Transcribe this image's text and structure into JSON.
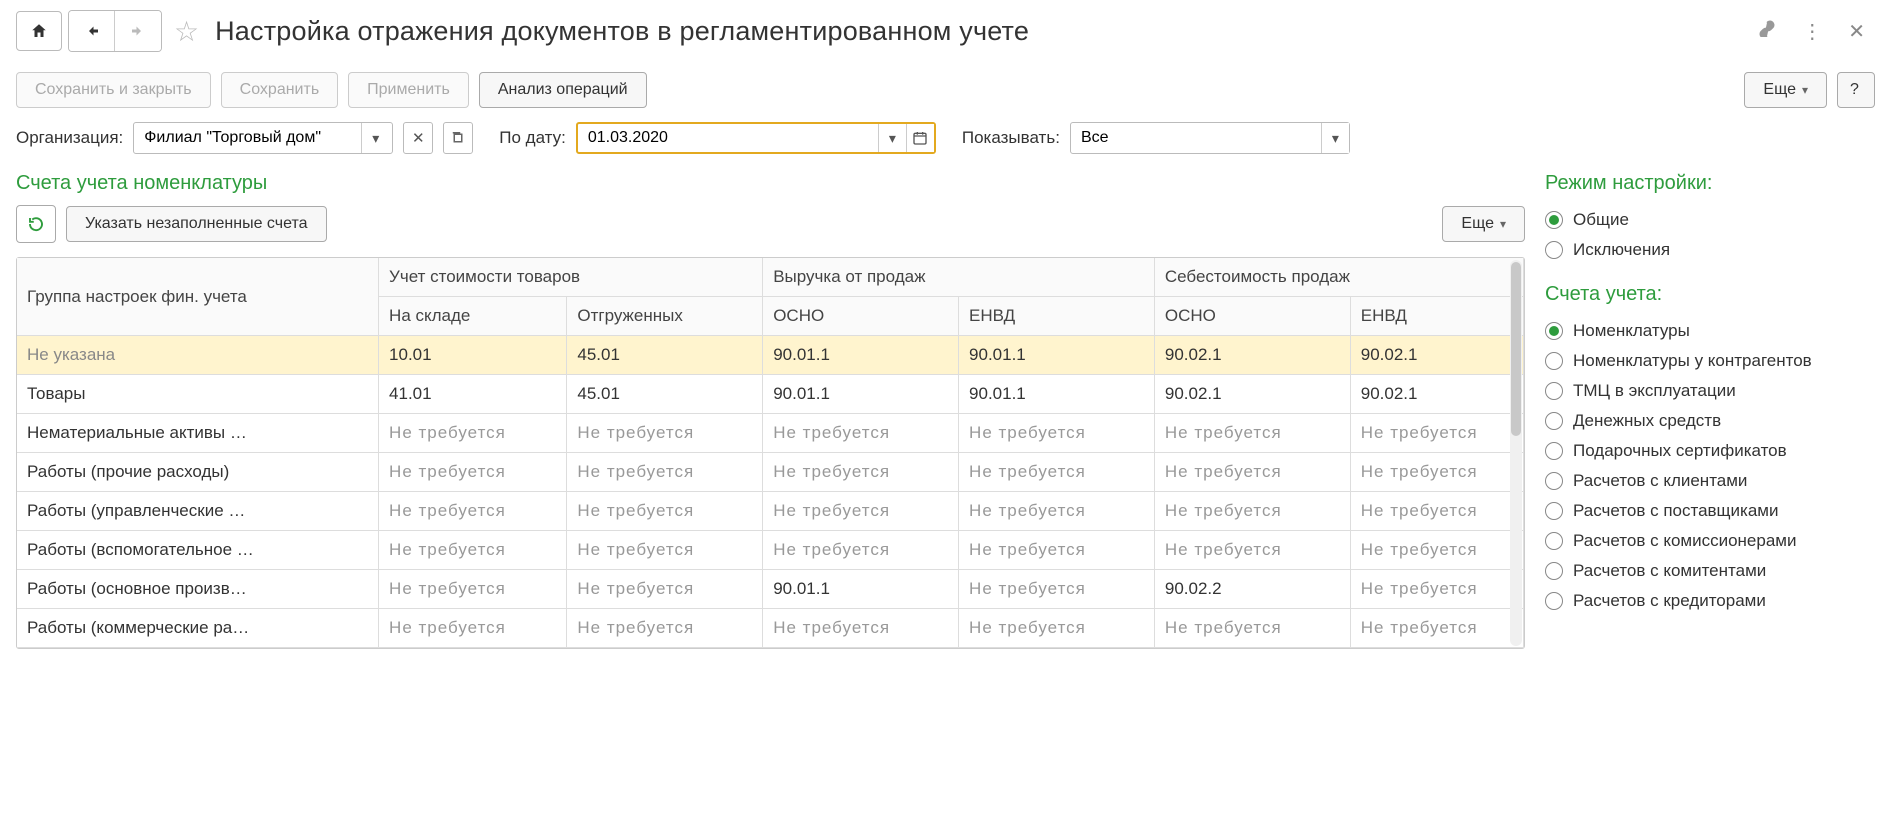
{
  "header": {
    "title": "Настройка отражения документов в регламентированном учете"
  },
  "toolbar": {
    "save_close": "Сохранить и закрыть",
    "save": "Сохранить",
    "apply": "Применить",
    "analyze": "Анализ операций",
    "more": "Еще",
    "help": "?"
  },
  "filters": {
    "org_label": "Организация:",
    "org_value": "Филиал \"Торговый дом\"",
    "date_label": "По дату:",
    "date_value": "01.03.2020",
    "show_label": "Показывать:",
    "show_value": "Все"
  },
  "section": {
    "title": "Счета учета номенклатуры",
    "fill_empty": "Указать незаполненные счета",
    "more": "Еще"
  },
  "table": {
    "columns": {
      "group": "Группа настроек фин. учета",
      "cost_group": "Учет стоимости товаров",
      "cost_stock": "На складе",
      "cost_shipped": "Отгруженных",
      "revenue_group": "Выручка от продаж",
      "rev_osno": "ОСНО",
      "rev_envd": "ЕНВД",
      "prime_group": "Себестоимость продаж",
      "prime_osno": "ОСНО",
      "prime_envd": "ЕНВД"
    },
    "na": "Не требуется",
    "rows": [
      {
        "name": "Не указана",
        "sel": true,
        "stock": "10.01",
        "shipped": "45.01",
        "rev_osno": "90.01.1",
        "rev_envd": "90.01.1",
        "prime_osno": "90.02.1",
        "prime_envd": "90.02.1"
      },
      {
        "name": "Товары",
        "sel": false,
        "stock": "41.01",
        "shipped": "45.01",
        "rev_osno": "90.01.1",
        "rev_envd": "90.01.1",
        "prime_osno": "90.02.1",
        "prime_envd": "90.02.1"
      },
      {
        "name": "Нематериальные активы …",
        "sel": false,
        "stock": null,
        "shipped": null,
        "rev_osno": null,
        "rev_envd": null,
        "prime_osno": null,
        "prime_envd": null
      },
      {
        "name": "Работы (прочие расходы)",
        "sel": false,
        "stock": null,
        "shipped": null,
        "rev_osno": null,
        "rev_envd": null,
        "prime_osno": null,
        "prime_envd": null
      },
      {
        "name": "Работы (управленческие …",
        "sel": false,
        "stock": null,
        "shipped": null,
        "rev_osno": null,
        "rev_envd": null,
        "prime_osno": null,
        "prime_envd": null
      },
      {
        "name": "Работы (вспомогательное …",
        "sel": false,
        "stock": null,
        "shipped": null,
        "rev_osno": null,
        "rev_envd": null,
        "prime_osno": null,
        "prime_envd": null
      },
      {
        "name": "Работы (основное произв…",
        "sel": false,
        "stock": null,
        "shipped": null,
        "rev_osno": "90.01.1",
        "rev_envd": null,
        "prime_osno": "90.02.2",
        "prime_envd": null
      },
      {
        "name": "Работы (коммерческие ра…",
        "sel": false,
        "stock": null,
        "shipped": null,
        "rev_osno": null,
        "rev_envd": null,
        "prime_osno": null,
        "prime_envd": null
      }
    ]
  },
  "right": {
    "mode_title": "Режим настройки:",
    "mode_options": [
      {
        "label": "Общие",
        "checked": true
      },
      {
        "label": "Исключения",
        "checked": false
      }
    ],
    "acc_title": "Счета учета:",
    "acc_options": [
      {
        "label": "Номенклатуры",
        "checked": true
      },
      {
        "label": "Номенклатуры у контрагентов",
        "checked": false
      },
      {
        "label": "ТМЦ в эксплуатации",
        "checked": false
      },
      {
        "label": "Денежных средств",
        "checked": false
      },
      {
        "label": "Подарочных сертификатов",
        "checked": false
      },
      {
        "label": "Расчетов с клиентами",
        "checked": false
      },
      {
        "label": "Расчетов с поставщиками",
        "checked": false
      },
      {
        "label": "Расчетов с комиссионерами",
        "checked": false
      },
      {
        "label": "Расчетов с комитентами",
        "checked": false
      },
      {
        "label": "Расчетов с кредиторами",
        "checked": false
      }
    ]
  }
}
